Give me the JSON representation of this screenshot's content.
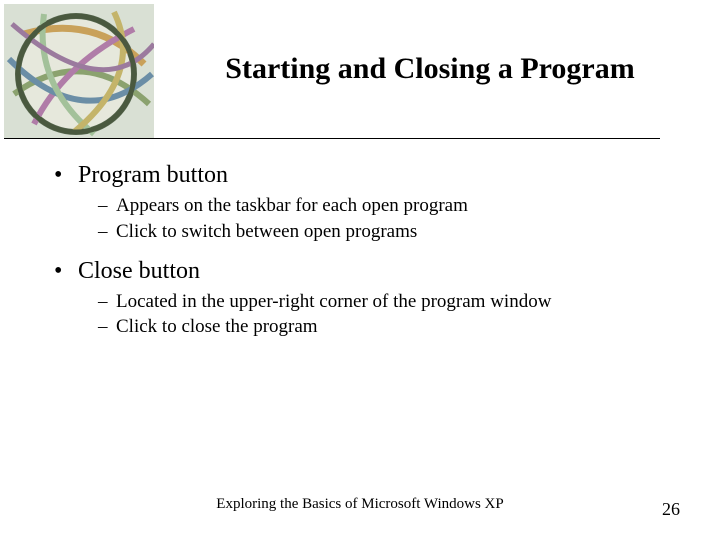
{
  "title": "Starting and Closing a Program",
  "bullets": [
    {
      "label": "Program button",
      "subs": [
        "Appears on the taskbar for each open program",
        "Click to switch between open programs"
      ]
    },
    {
      "label": "Close button",
      "subs": [
        "Located in the upper-right corner of the program window",
        "Click to close the program"
      ]
    }
  ],
  "footer": "Exploring the Basics of Microsoft Windows XP",
  "page_number": "26"
}
